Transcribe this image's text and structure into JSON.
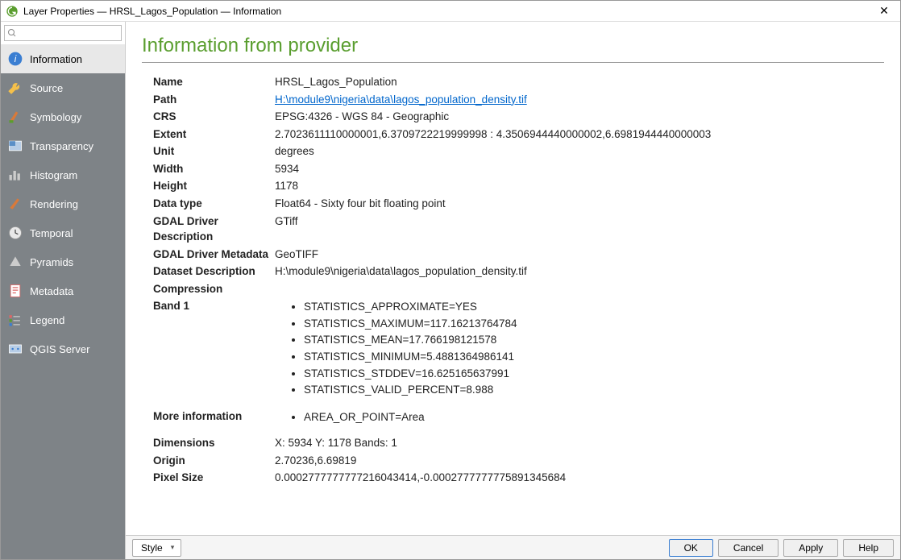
{
  "titlebar": {
    "title": "Layer Properties — HRSL_Lagos_Population — Information"
  },
  "sidebar": {
    "search_placeholder": "",
    "items": [
      {
        "label": "Information"
      },
      {
        "label": "Source"
      },
      {
        "label": "Symbology"
      },
      {
        "label": "Transparency"
      },
      {
        "label": "Histogram"
      },
      {
        "label": "Rendering"
      },
      {
        "label": "Temporal"
      },
      {
        "label": "Pyramids"
      },
      {
        "label": "Metadata"
      },
      {
        "label": "Legend"
      },
      {
        "label": "QGIS Server"
      }
    ]
  },
  "section": {
    "title": "Information from provider"
  },
  "info": {
    "name_label": "Name",
    "name": "HRSL_Lagos_Population",
    "path_label": "Path",
    "path": "H:\\module9\\nigeria\\data\\lagos_population_density.tif",
    "crs_label": "CRS",
    "crs": "EPSG:4326 - WGS 84 - Geographic",
    "extent_label": "Extent",
    "extent": "2.7023611110000001,6.3709722219999998 : 4.3506944440000002,6.6981944440000003",
    "unit_label": "Unit",
    "unit": "degrees",
    "width_label": "Width",
    "width": "5934",
    "height_label": "Height",
    "height": "1178",
    "datatype_label": "Data type",
    "datatype": "Float64 - Sixty four bit floating point",
    "gdal_desc_label": "GDAL Driver Description",
    "gdal_desc": "GTiff",
    "gdal_meta_label": "GDAL Driver Metadata",
    "gdal_meta": "GeoTIFF",
    "dataset_desc_label": "Dataset Description",
    "dataset_desc": "H:\\module9\\nigeria\\data\\lagos_population_density.tif",
    "compression_label": "Compression",
    "compression": "",
    "band1_label": "Band 1",
    "band1": [
      "STATISTICS_APPROXIMATE=YES",
      "STATISTICS_MAXIMUM=117.16213764784",
      "STATISTICS_MEAN=17.766198121578",
      "STATISTICS_MINIMUM=5.4881364986141",
      "STATISTICS_STDDEV=16.625165637991",
      "STATISTICS_VALID_PERCENT=8.988"
    ],
    "more_info_label": "More information",
    "more_info": [
      "AREA_OR_POINT=Area"
    ],
    "dimensions_label": "Dimensions",
    "dimensions": "X: 5934 Y: 1178 Bands: 1",
    "origin_label": "Origin",
    "origin": "2.70236,6.69819",
    "pixel_size_label": "Pixel Size",
    "pixel_size": "0.0002777777777216043414,-0.0002777777775891345684"
  },
  "buttons": {
    "style": "Style",
    "ok": "OK",
    "cancel": "Cancel",
    "apply": "Apply",
    "help": "Help"
  }
}
